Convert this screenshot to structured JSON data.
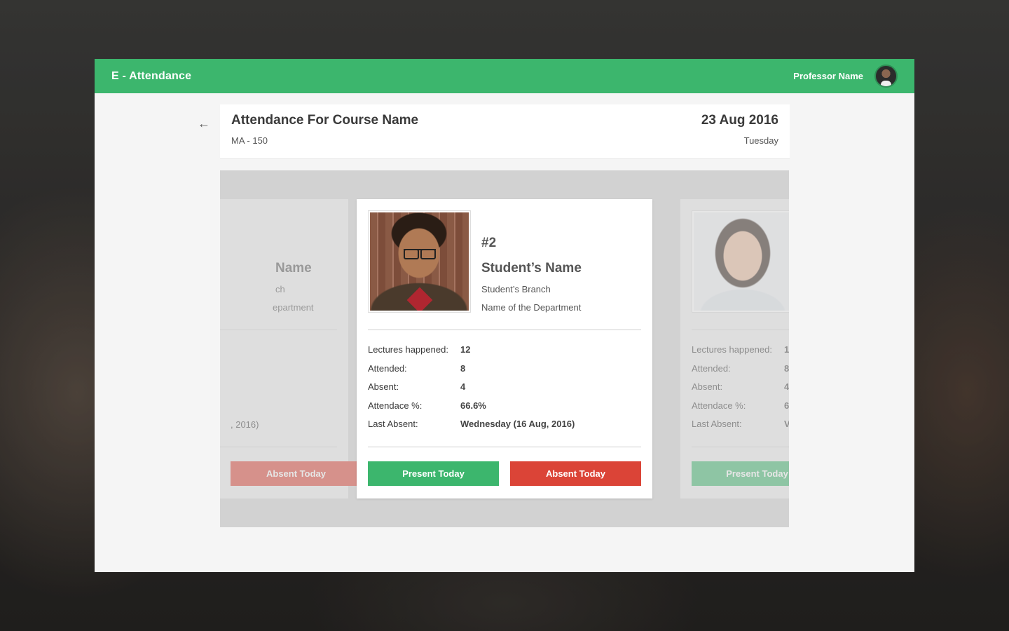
{
  "header": {
    "app_title": "E - Attendance",
    "professor_name": "Professor Name"
  },
  "course": {
    "title": "Attendance For Course Name",
    "code": "MA - 150",
    "date": "23 Aug 2016",
    "day": "Tuesday"
  },
  "labels": {
    "lectures": "Lectures happened:",
    "attended": "Attended:",
    "absent": "Absent:",
    "percent": "Attendace %:",
    "last_absent": "Last Absent:",
    "present_btn": "Present Today",
    "absent_btn": "Absent Today"
  },
  "cards": {
    "prev": {
      "name": "Name",
      "branch": "ch",
      "department": "epartment",
      "last_absent": ", 2016)",
      "absent_btn": "Absent Today"
    },
    "current": {
      "roll": "#2",
      "name": "Student’s Name",
      "branch": "Student’s Branch",
      "department": "Name of the Department",
      "lectures": "12",
      "attended": "8",
      "absent": "4",
      "percent": "66.6%",
      "last_absent": "Wednesday (16 Aug, 2016)"
    },
    "next": {
      "lectures": "1",
      "attended": "8",
      "absent": "4",
      "percent": "6",
      "last_absent": "V",
      "present_btn": "Present Today"
    }
  },
  "colors": {
    "brand_green": "#3cb66d",
    "absent_red": "#db4437"
  },
  "icons": {
    "back": "arrow-left-icon"
  }
}
